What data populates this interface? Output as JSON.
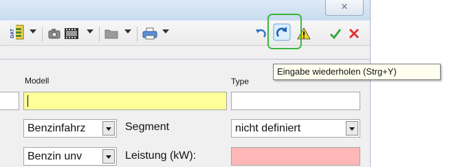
{
  "window": {
    "close_glyph": "✕"
  },
  "toolbar": {
    "buttons": [
      {
        "name": "dat-icon"
      },
      {
        "name": "camera-icon"
      },
      {
        "name": "film-icon"
      },
      {
        "name": "folder-icon"
      },
      {
        "name": "printer-icon"
      },
      {
        "name": "undo-icon"
      },
      {
        "name": "redo-icon"
      },
      {
        "name": "warning-icon"
      },
      {
        "name": "check-icon"
      },
      {
        "name": "cancel-icon"
      }
    ],
    "dat_logo_text": "DAT",
    "tooltip": "Eingabe wiederholen (Strg+Y)"
  },
  "form": {
    "modell_label": "Modell",
    "type_label": "Type",
    "modell_value": "",
    "type_value": "",
    "fuel_type_value": "Benzinfahrz",
    "segment_label": "Segment",
    "segment_value": "nicht definiert",
    "fuel_value": "Benzin unv",
    "power_label": "Leistung (kW):",
    "power_value": ""
  },
  "colors": {
    "required_field": "#ffff99",
    "error_field": "#ffb7b7",
    "highlight": "#3ab53a"
  }
}
